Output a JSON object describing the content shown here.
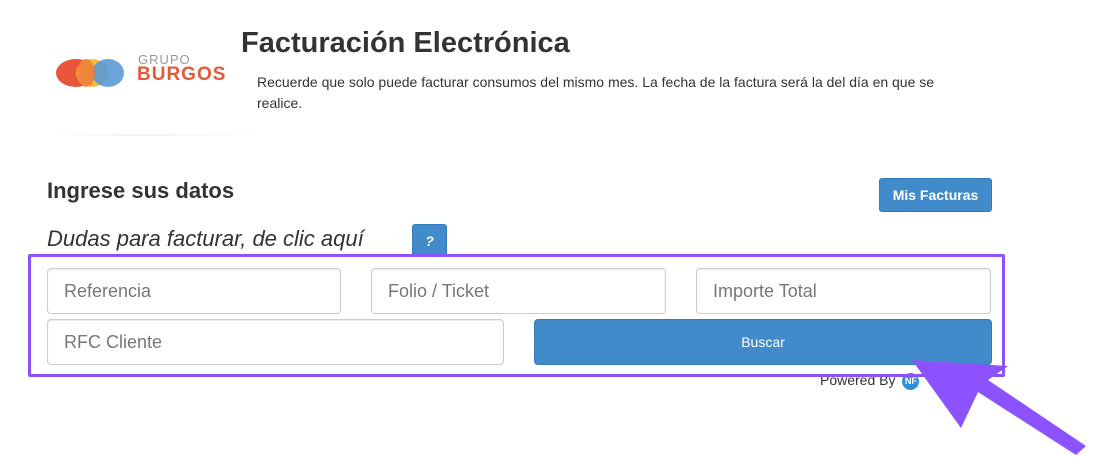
{
  "brand": {
    "small": "GRUPO",
    "big": "BURGOS",
    "colors": {
      "orange": "#e2593c",
      "yellow": "#f2b632",
      "blue": "#5a9ad6",
      "gray": "#9a9a9a"
    }
  },
  "header": {
    "title": "Facturación Electrónica",
    "notice": "Recuerde que solo puede facturar consumos del mismo mes. La fecha de la factura será la del día en que se realice."
  },
  "section": {
    "title": "Ingrese sus datos",
    "help_text": "Dudas para facturar, de clic aquí",
    "help_button": "?"
  },
  "toolbar": {
    "mis_facturas": "Mis Facturas"
  },
  "form": {
    "referencia_placeholder": "Referencia",
    "folio_placeholder": "Folio / Ticket",
    "importe_placeholder": "Importe Total",
    "rfc_placeholder": "RFC Cliente",
    "buscar_label": "Buscar"
  },
  "footer": {
    "powered_by": "Powered By",
    "badge": "NF"
  },
  "colors": {
    "primary": "#428bca",
    "highlight": "#8c52ff",
    "arrow": "#8c52ff"
  },
  "icons": {
    "logo": "grupo-burgos-logo",
    "arrow": "annotation-arrow-icon"
  }
}
